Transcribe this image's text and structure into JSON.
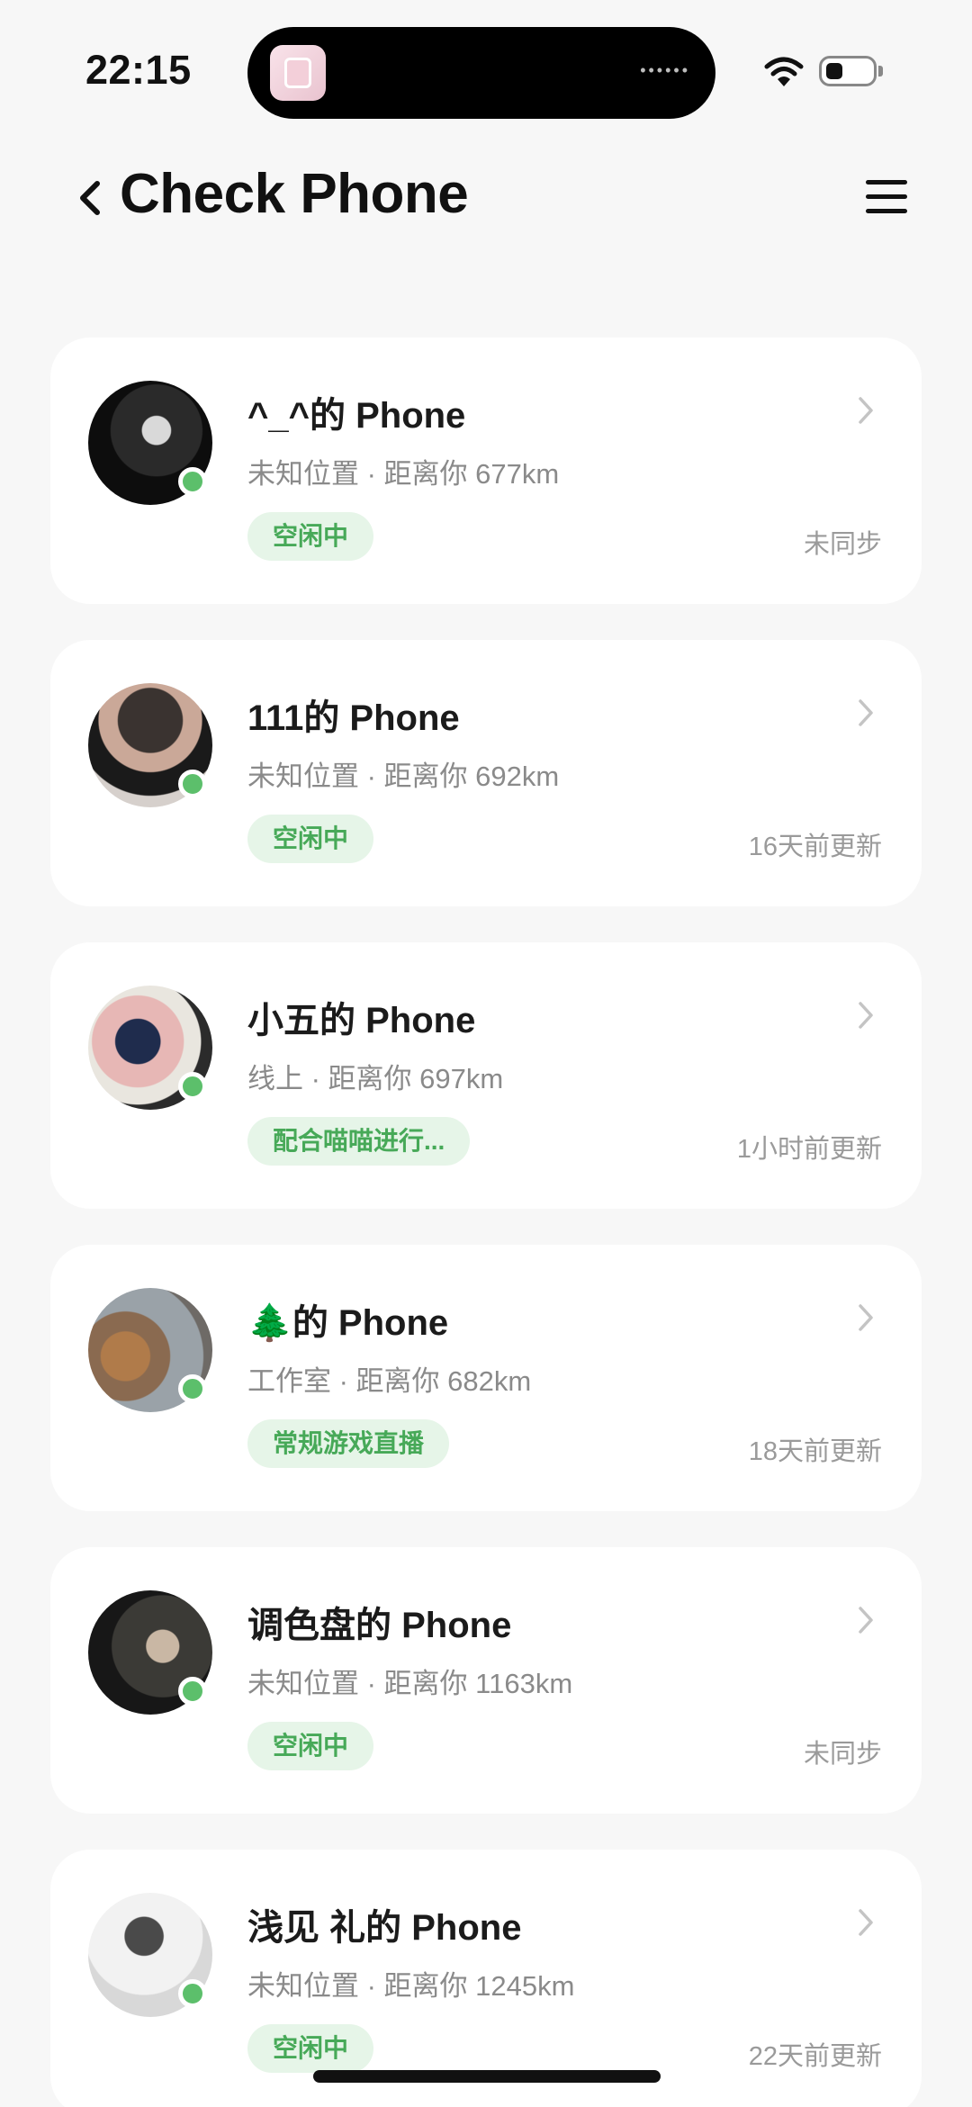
{
  "status_bar": {
    "time": "22:15",
    "island_dots": "••••••"
  },
  "header": {
    "title": "Check Phone"
  },
  "colors": {
    "accent_green": "#47a958",
    "badge_bg": "#e6f5e8",
    "online": "#5cbf6b"
  },
  "phones": [
    {
      "title": "^_^的 Phone",
      "subtitle": "未知位置 · 距离你 677km",
      "status": "空闲中",
      "sync": "未同步"
    },
    {
      "title": "111的 Phone",
      "subtitle": "未知位置 · 距离你 692km",
      "status": "空闲中",
      "sync": "16天前更新"
    },
    {
      "title": "小五的 Phone",
      "subtitle": "线上 · 距离你 697km",
      "status": "配合喵喵进行...",
      "sync": "1小时前更新"
    },
    {
      "title_emoji": "🌲",
      "title": "的 Phone",
      "subtitle": "工作室 · 距离你 682km",
      "status": "常规游戏直播",
      "sync": "18天前更新"
    },
    {
      "title": "调色盘的 Phone",
      "subtitle": "未知位置 · 距离你 1163km",
      "status": "空闲中",
      "sync": "未同步"
    },
    {
      "title": "浅见 礼的 Phone",
      "subtitle": "未知位置 · 距离你 1245km",
      "status": "空闲中",
      "sync": "22天前更新"
    }
  ]
}
